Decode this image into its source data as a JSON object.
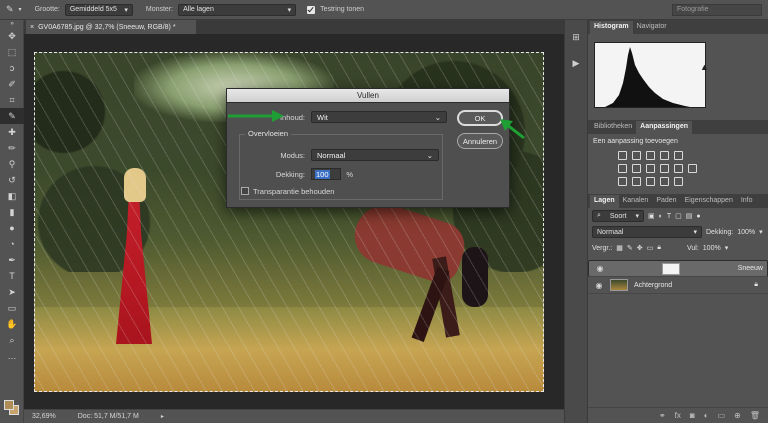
{
  "options_bar": {
    "size_label": "Grootte:",
    "size_value": "Gemiddeld 5x5",
    "sample_label": "Monster:",
    "sample_value": "Alle lagen",
    "ring_label": "Testring tonen",
    "workspace": "Fotografie"
  },
  "document": {
    "tab_title": "GV0A6785.jpg @ 32,7% (Sneeuw, RGB/8) *",
    "zoom": "32,69%",
    "doc_info": "Doc: 51,7 M/51,7 M"
  },
  "dialog": {
    "title": "Vullen",
    "content_label": "Inhoud:",
    "content_value": "Wit",
    "blend_legend": "Overvloeien",
    "mode_label": "Modus:",
    "mode_value": "Normaal",
    "opacity_label": "Dekking:",
    "opacity_value": "100",
    "opacity_unit": "%",
    "preserve_label": "Transparantie behouden",
    "ok_label": "OK",
    "cancel_label": "Annuleren"
  },
  "panels": {
    "top_tabs": [
      "Histogram",
      "Navigator"
    ],
    "mid_tabs": [
      "Bibliotheken",
      "Aanpassingen"
    ],
    "adjust_title": "Een aanpassing toevoegen",
    "layer_tabs": [
      "Lagen",
      "Kanalen",
      "Paden",
      "Eigenschappen",
      "Info"
    ],
    "filter_kind": "Soort",
    "blend_mode": "Normaal",
    "opacity_label": "Dekking:",
    "opacity_value": "100%",
    "lock_label": "Vergr.:",
    "fill_label": "Vul:",
    "fill_value": "100%",
    "layers": [
      {
        "name": "Sneeuw",
        "selected": true
      },
      {
        "name": "Achtergrond",
        "selected": false
      }
    ]
  },
  "colors": {
    "arrow": "#1e9e35",
    "selection_highlight": "#3b6fc4",
    "foreground_color": "#b08c56"
  }
}
